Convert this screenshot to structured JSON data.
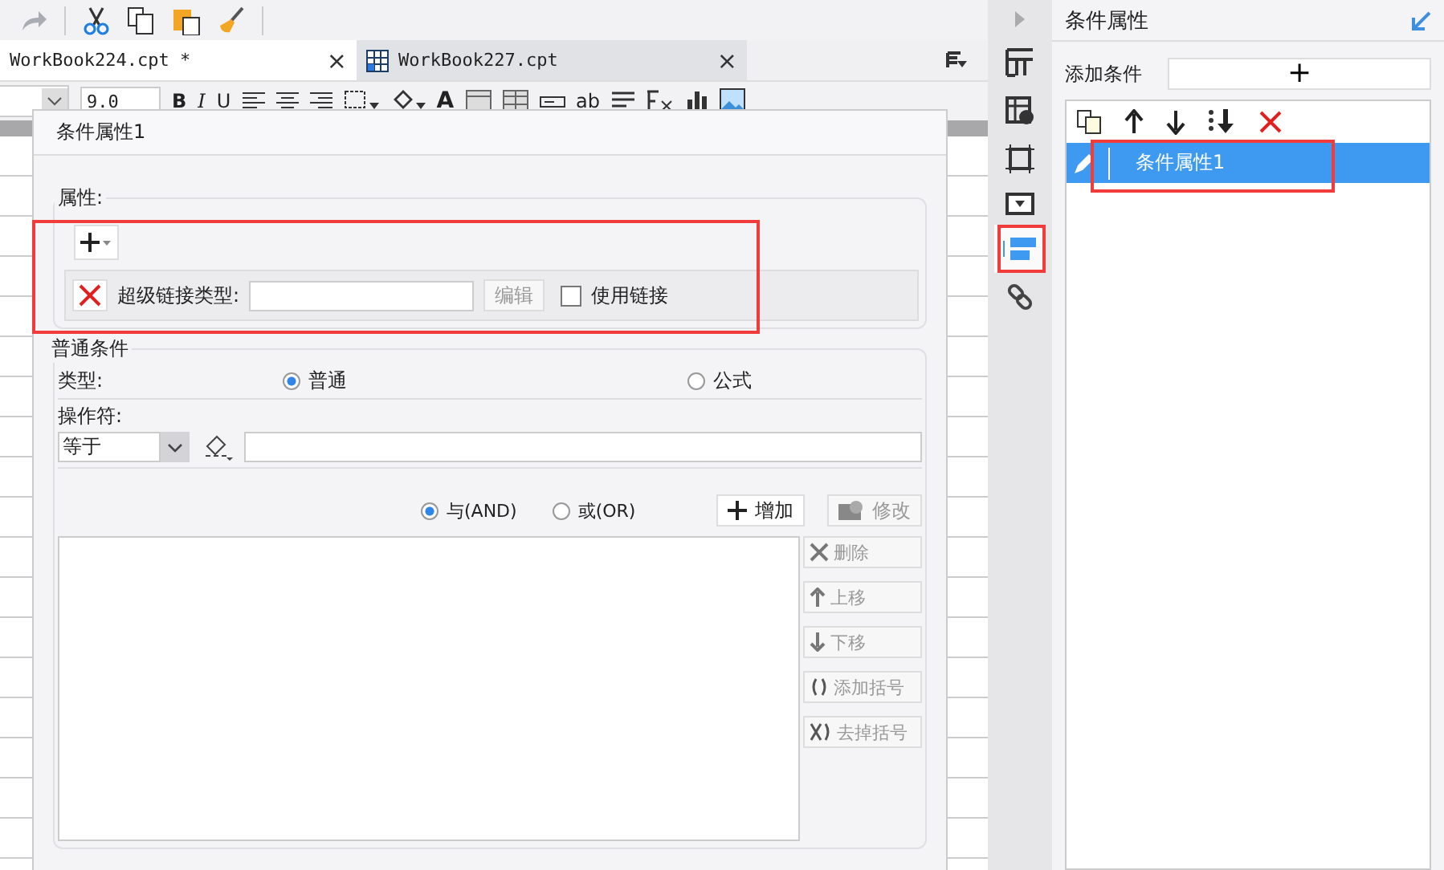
{
  "tabs": [
    {
      "label": "WorkBook224.cpt *",
      "selected": true,
      "close": "×"
    },
    {
      "label": "WorkBook227.cpt",
      "selected": false,
      "close": "×"
    }
  ],
  "format_bar": {
    "font_size": "9.0",
    "bold": "B",
    "italic": "I",
    "underline": "U",
    "font_color": "A",
    "text_tool": "ab"
  },
  "dialog": {
    "title": "条件属性1",
    "properties": {
      "legend": "属性:",
      "hyperlink_label": "超级链接类型:",
      "edit_button": {
        "label": "编辑",
        "disabled": true
      },
      "use_link": {
        "label": "使用链接",
        "checked": false
      }
    },
    "condition": {
      "legend": "普通条件",
      "type_label": "类型:",
      "type_options": [
        {
          "label": "普通",
          "selected": true
        },
        {
          "label": "公式",
          "selected": false
        }
      ],
      "operator_label": "操作符:",
      "operator": "等于",
      "logic": [
        {
          "label": "与(AND)",
          "selected": true
        },
        {
          "label": "或(OR)",
          "selected": false
        }
      ],
      "top_buttons": [
        {
          "kind": "add",
          "label": "增加",
          "disabled": false
        },
        {
          "kind": "modify",
          "label": "修改",
          "disabled": true
        }
      ],
      "side_buttons": [
        {
          "kind": "delete",
          "label": "删除",
          "disabled": true
        },
        {
          "kind": "up",
          "label": "上移",
          "disabled": true
        },
        {
          "kind": "down",
          "label": "下移",
          "disabled": true
        },
        {
          "kind": "add-paren",
          "label": "添加括号",
          "disabled": true
        },
        {
          "kind": "remove-paren",
          "label": "去掉括号",
          "disabled": true
        }
      ]
    }
  },
  "side_panel": {
    "title": "条件属性",
    "add_label": "添加条件",
    "add_button": "+",
    "items": [
      {
        "label": "条件属性1",
        "selected": true
      }
    ]
  }
}
